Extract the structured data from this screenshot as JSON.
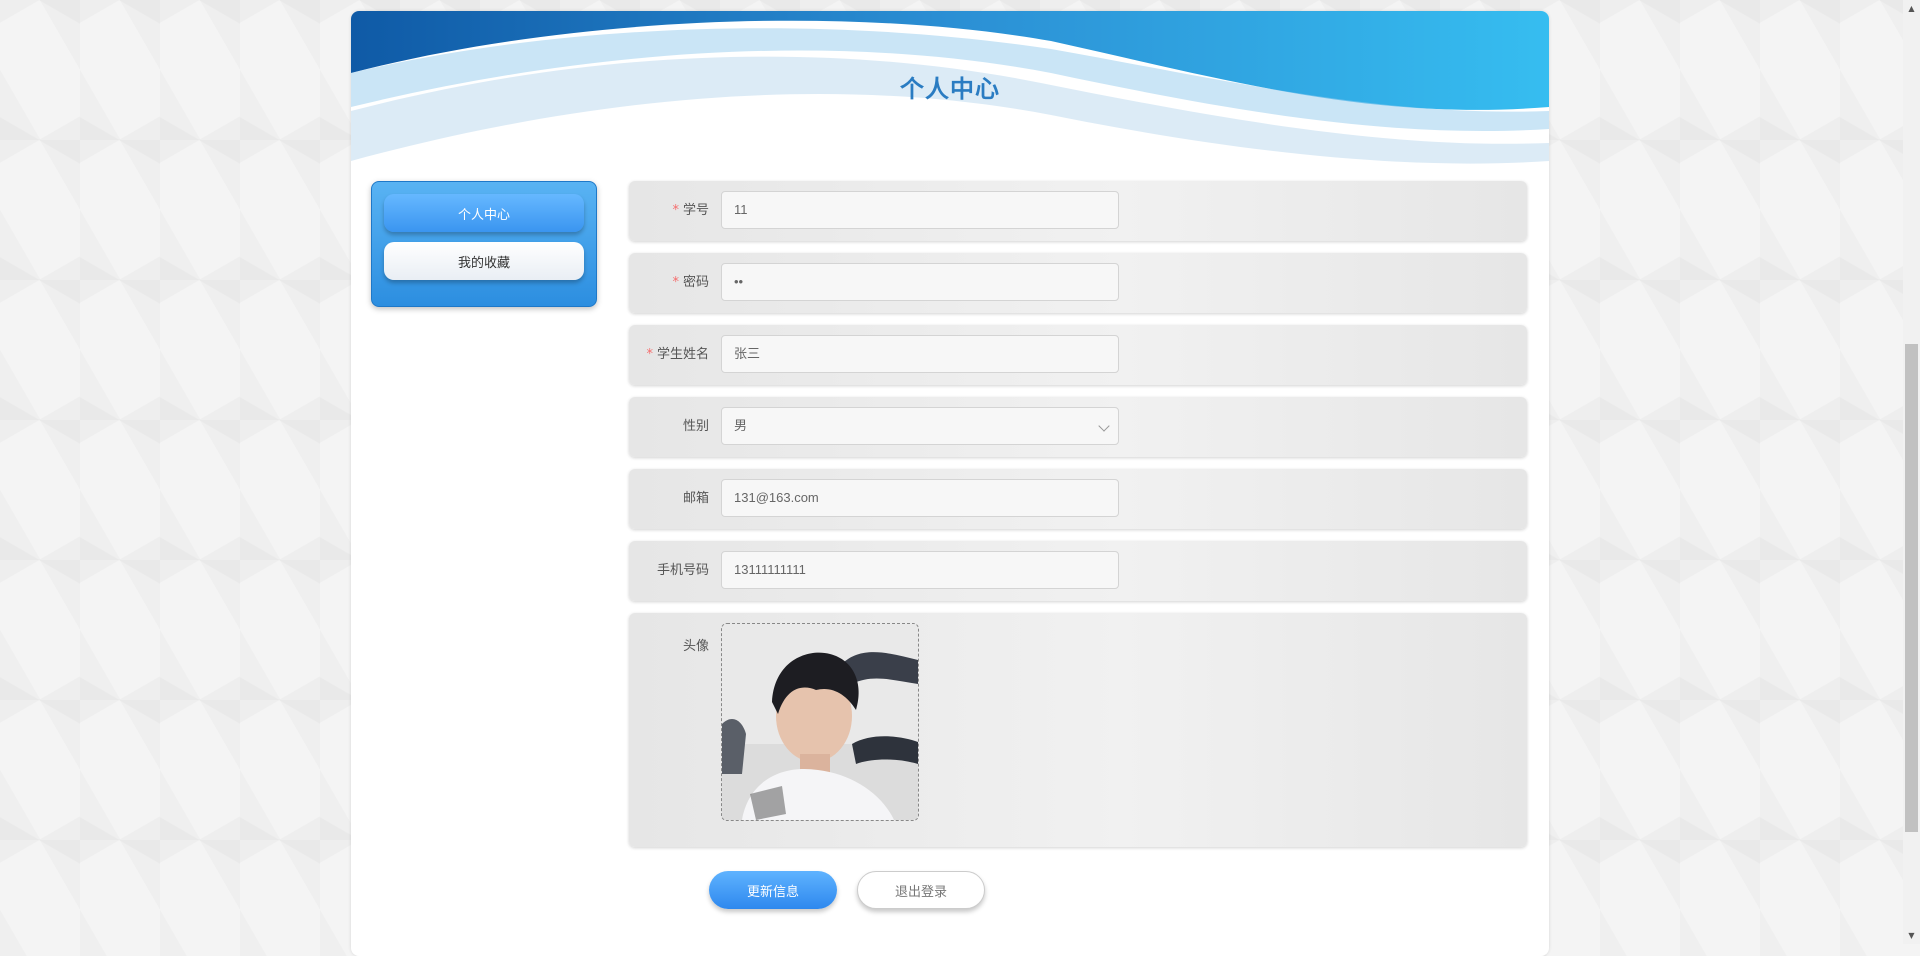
{
  "header": {
    "title": "个人中心"
  },
  "sidebar": {
    "items": [
      {
        "label": "个人中心",
        "active": true
      },
      {
        "label": "我的收藏",
        "active": false
      }
    ]
  },
  "form": {
    "required_mark": "*",
    "student_no": {
      "label": "学号",
      "value": "11",
      "required": true
    },
    "password": {
      "label": "密码",
      "value": "••",
      "required": true
    },
    "student_name": {
      "label": "学生姓名",
      "value": "张三",
      "required": true
    },
    "gender": {
      "label": "性别",
      "value": "男"
    },
    "email": {
      "label": "邮箱",
      "value": "131@163.com"
    },
    "phone": {
      "label": "手机号码",
      "value": "13111111111"
    },
    "avatar": {
      "label": "头像"
    }
  },
  "actions": {
    "update_label": "更新信息",
    "logout_label": "退出登录"
  },
  "colors": {
    "accent": "#3a95f0",
    "title": "#2a7cc2",
    "required": "#f56c6c"
  },
  "icons": {
    "select": "chevron-down-icon",
    "scroll_up": "scroll-up-arrow-icon",
    "scroll_down": "scroll-down-arrow-icon"
  }
}
